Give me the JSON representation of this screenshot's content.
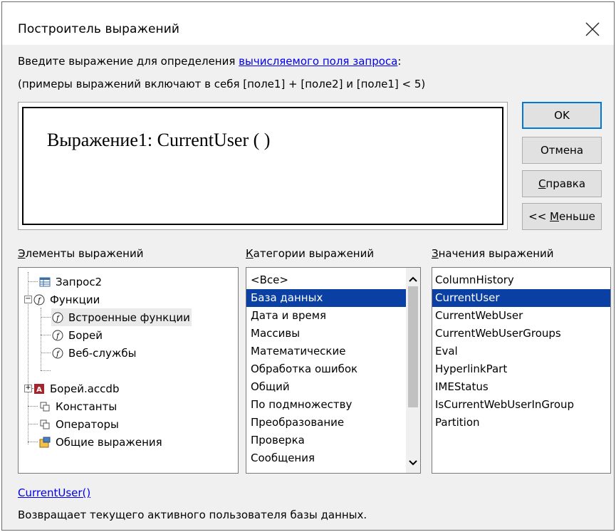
{
  "dialog": {
    "title": "Построитель выражений",
    "prompt_text": "Введите выражение для определения ",
    "prompt_link": "вычисляемого поля запроса",
    "prompt_end": ":",
    "hint": "(примеры выражений включают в себя [поле1] + [поле2] и [поле1] < 5)",
    "expression": "Выражение1: CurrentUser ( )"
  },
  "buttons": {
    "ok": "OK",
    "cancel": "Отмена",
    "help_u": "С",
    "help_rest": "правка",
    "less_pre": "<< ",
    "less_u": "М",
    "less_rest": "еньше"
  },
  "labels": {
    "elements_u": "Э",
    "elements_rest": "лементы выражений",
    "categories_u": "К",
    "categories_rest": "атегории выражений",
    "values_u": "З",
    "values_rest": "начения выражений"
  },
  "tree": [
    {
      "label": "Запрос2",
      "icon": "query-icon"
    },
    {
      "label": "Функции",
      "icon": "function-icon"
    },
    {
      "label": "Встроенные функции",
      "icon": "function-icon"
    },
    {
      "label": "Борей",
      "icon": "function-icon"
    },
    {
      "label": "Веб-службы",
      "icon": "function-icon"
    },
    {
      "label": "Борей.accdb",
      "icon": "database-icon"
    },
    {
      "label": "Константы",
      "icon": "constants-icon"
    },
    {
      "label": "Операторы",
      "icon": "operators-icon"
    },
    {
      "label": "Общие выражения",
      "icon": "common-expressions-icon"
    }
  ],
  "categories": [
    "<Все>",
    "База данных",
    "Дата и время",
    "Массивы",
    "Математические",
    "Обработка ошибок",
    "Общий",
    "По подмножеству",
    "Преобразование",
    "Проверка",
    "Сообщения"
  ],
  "categories_selected": 1,
  "values": [
    "ColumnHistory",
    "CurrentUser",
    "CurrentWebUser",
    "CurrentWebUserGroups",
    "Eval",
    "HyperlinkPart",
    "IMEStatus",
    "IsCurrentWebUserInGroup",
    "Partition"
  ],
  "values_selected": 1,
  "footer": {
    "link": "CurrentUser()",
    "description": "Возвращает текущего активного пользователя базы данных."
  },
  "colors": {
    "selection": "#0a3fa3",
    "link": "#0000ee",
    "default_button_border": "#0078d7",
    "dialog_bg": "#f0f0f0"
  }
}
